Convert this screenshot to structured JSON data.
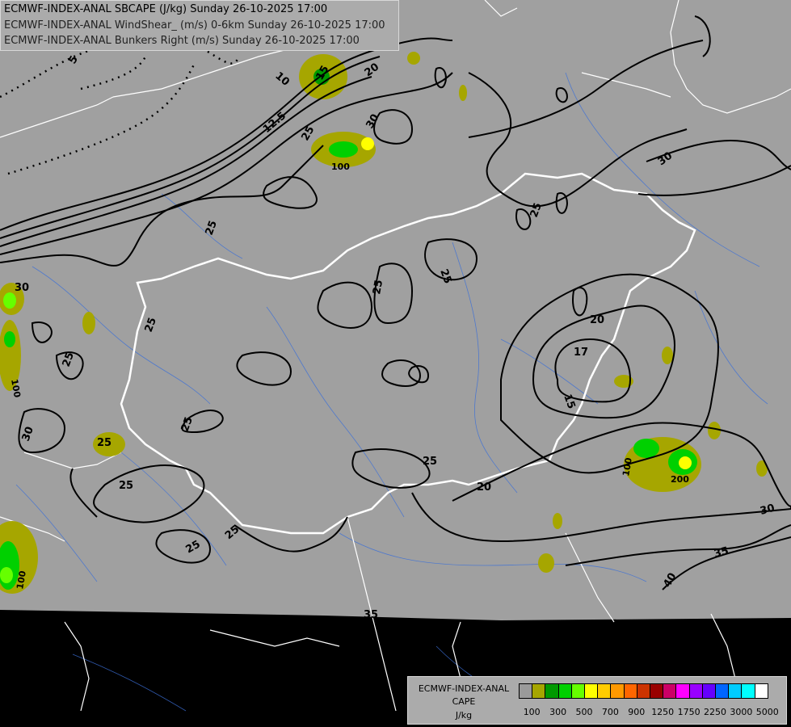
{
  "header": {
    "line1": "ECMWF-INDEX-ANAL SBCAPE (J/kg) Sunday 26-10-2025 17:00",
    "line2": "ECMWF-INDEX-ANAL WindShear_ (m/s) 0-6km Sunday 26-10-2025 17:00",
    "line3": "ECMWF-INDEX-ANAL Bunkers Right (m/s) Sunday 26-10-2025 17:00"
  },
  "legend": {
    "line1": "ECMWF-INDEX-ANAL",
    "line2": "CAPE",
    "line3": "J/kg",
    "ticks": [
      "100",
      "300",
      "500",
      "700",
      "900",
      "1250",
      "1750",
      "2250",
      "3000",
      "5000"
    ],
    "colors": [
      "#9a9a9a",
      "#a6a600",
      "#009900",
      "#00d000",
      "#66ff00",
      "#ffff00",
      "#ffcc00",
      "#ff9900",
      "#ff6600",
      "#cc3300",
      "#990000",
      "#cc0066",
      "#ff00ff",
      "#9900ff",
      "#6600ff",
      "#0066ff",
      "#00ccff",
      "#00ffff",
      "#ffffff"
    ]
  },
  "contour_labels": [
    "5",
    "10",
    "12.5",
    "15",
    "20",
    "25",
    "30",
    "17",
    "15",
    "25",
    "25",
    "25",
    "25",
    "25",
    "25",
    "25",
    "25",
    "30",
    "25",
    "25",
    "20",
    "20",
    "25",
    "30",
    "30",
    "35",
    "40",
    "35",
    "100",
    "100",
    "100",
    "100",
    "200",
    "25",
    "30"
  ]
}
